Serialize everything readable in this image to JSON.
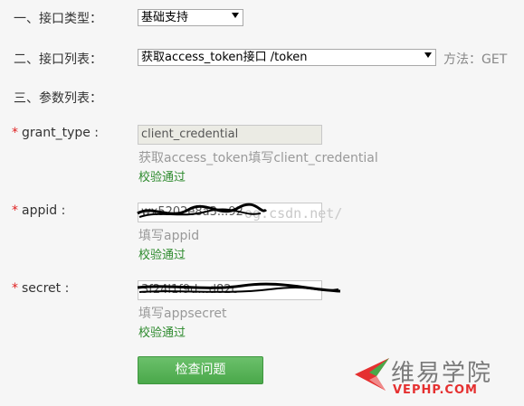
{
  "form": {
    "type_label": "一、接口类型：",
    "type_value": "基础支持",
    "list_label": "二、接口列表：",
    "list_value": "获取access_token接口 /token",
    "method_text": "方法：GET",
    "params_label": "三、参数列表：",
    "required_mark": "*",
    "grant_type": {
      "label": "grant_type :",
      "value": "client_credential",
      "hint": "获取access_token填写client_credential",
      "status": "校验通过"
    },
    "appid": {
      "label": "appid :",
      "value": "wx5202e8a3...92",
      "hint": "填写appid",
      "status": "校验通过"
    },
    "secret": {
      "label": "secret :",
      "value": "3f24l1f9d...d82c",
      "hint": "填写appsecret",
      "status": "校验通过"
    },
    "submit_label": "检查问题"
  },
  "watermark": {
    "blog_text": "og.csdn.net/",
    "logo_main": "维易学院",
    "logo_sub": "VEPHP.COM"
  },
  "colors": {
    "background": "#f6f6f6",
    "required": "#e02020",
    "ok": "#2d8a2d",
    "button": "#4aa84a",
    "logo_accent": "#e53030"
  }
}
